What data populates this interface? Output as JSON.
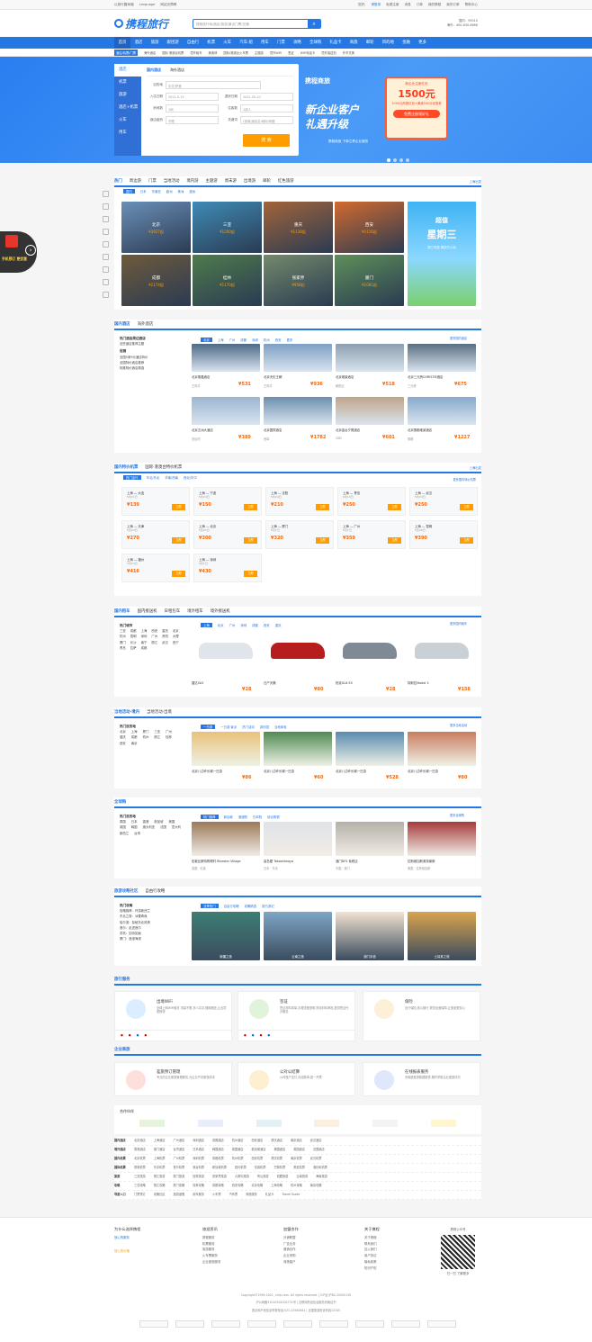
{
  "topbar": {
    "left": [
      "以旅行圆幸福",
      "Language",
      "网站无障碍"
    ],
    "right": [
      "您好,",
      "请登录",
      "免费注册",
      "消息",
      "订单",
      "我的携程",
      "我的订单",
      "帮助中心"
    ]
  },
  "header": {
    "logo": "携程旅行",
    "search_placeholder": "搜索旅行地/酒店/旅游/景点门票/交通",
    "hotline1": "国内：95010",
    "hotline2": "海外：400-830-6666"
  },
  "nav": [
    "首页",
    "酒店",
    "旅游",
    "跟团游",
    "自由行",
    "机票",
    "火车",
    "汽车·船",
    "用车",
    "门票",
    "攻略",
    "全球购",
    "礼品卡",
    "商旅",
    "邮轮",
    "目的地",
    "金融",
    "更多"
  ],
  "subnav": {
    "tag": "酒店/机票/门票",
    "items": [
      "海外酒店",
      "国际·港澳台机票",
      "境外租车",
      "美食林",
      "国际/港澳台火车票",
      "主题游",
      "境外WiFi",
      "签证",
      "WiFi电话卡",
      "境外接送机",
      "外币兑换"
    ]
  },
  "booking": {
    "side_tabs": [
      "酒店",
      "机票",
      "旅游",
      "酒店+机票",
      "火车",
      "用车"
    ],
    "tabs": [
      "国内酒店",
      "海外酒店"
    ],
    "labels": {
      "dest": "目的地",
      "checkin": "入住日期",
      "checkout": "退房日期",
      "rooms": "房间数",
      "guests": "住客数",
      "level": "酒店级别",
      "keyword": "关键词"
    },
    "values": {
      "dest": "中文/拼音",
      "checkin": "2021-5-19",
      "checkout": "2021-05-20",
      "rooms": "1间",
      "guests": "1成人",
      "level": "不限",
      "keyword": "(选填)酒店名/地标/商圈"
    },
    "search": "搜 索"
  },
  "promo": {
    "brand": "携程商旅",
    "line1": "新企业客户",
    "line2": "礼遇升级",
    "sub": "携程商旅 下单立享企业服务",
    "card_title": "新企业注册红包",
    "card_amount": "1500元",
    "card_note": "1000元商旅红包+满减500元优惠券",
    "card_btn": "免费注册领好礼"
  },
  "float_red": {
    "title": "手机预订 更优惠"
  },
  "dest": {
    "tabs": [
      "热门",
      "周边游",
      "门票",
      "当地活动",
      "境内游",
      "主题游",
      "周末游",
      "出境游",
      "邮轮",
      "红色旅游"
    ],
    "more": "上海出发",
    "filters": [
      "国内",
      "日本",
      "东南亚",
      "欧洲",
      "美洲",
      "澳洲"
    ],
    "items": [
      {
        "name": "北京",
        "price": "¥3927起"
      },
      {
        "name": "三亚",
        "price": "¥1200起"
      },
      {
        "name": "重庆",
        "price": "¥1138起"
      },
      {
        "name": "西安",
        "price": "¥1116起"
      },
      {
        "name": "成都",
        "price": "¥1174起"
      },
      {
        "name": "桂林",
        "price": "¥1170起"
      },
      {
        "name": "张家界",
        "price": "¥958起"
      },
      {
        "name": "厦门",
        "price": "¥1081起"
      }
    ],
    "ad": {
      "l1": "超值",
      "l2": "星期三",
      "l3": "周三特惠 周末开心玩"
    }
  },
  "hotel": {
    "tabs": [
      "国内酒店",
      "海外酒店"
    ],
    "left_title": "热门酒店周边酒店",
    "left_sub": "这些酒店推荐主题",
    "left_h": "促销",
    "left_items": [
      "全国5家9元酒店特价",
      "全国特价酒店推荐",
      "特推特价酒店精选"
    ],
    "cities": [
      "北京",
      "上海",
      "广州",
      "成都",
      "深圳",
      "杭州",
      "西安",
      "更多"
    ],
    "more": "更多国内酒店",
    "items": [
      {
        "name": "北京丽晶酒店",
        "loc": "王府井",
        "price": "¥531"
      },
      {
        "name": "北京天伦王朝",
        "loc": "王府井",
        "price": "¥936"
      },
      {
        "name": "北京维景酒店",
        "loc": "朝阳区",
        "price": "¥518"
      },
      {
        "name": "北京三元桥CHRISTIE酒店",
        "loc": "三元桥",
        "price": "¥675"
      },
      {
        "name": "北京五洲大酒店",
        "loc": "亚运村",
        "price": "¥389"
      },
      {
        "name": "北京国宾酒店",
        "loc": "西单",
        "price": "¥1782"
      },
      {
        "name": "北京金台夕照酒店",
        "loc": "CBD",
        "price": "¥601"
      },
      {
        "name": "北京丽都维景酒店",
        "loc": "丽都",
        "price": "¥1227"
      }
    ]
  },
  "flight": {
    "tabs": [
      "国内特价机票",
      "国际·港澳台特价机票"
    ],
    "more": "上海出发",
    "filters": [
      "热门出行",
      "华北/东北",
      "华南/西南",
      "西北/华中"
    ],
    "right": "更多国内特价机票",
    "items": [
      {
        "route": "上海 — 大连",
        "date": "5月21日",
        "price": "¥139"
      },
      {
        "route": "上海 — 宁波",
        "date": "5月24日",
        "price": "¥150"
      },
      {
        "route": "上海 — 沈阳",
        "date": "5月24日",
        "price": "¥210"
      },
      {
        "route": "上海 — 青岛",
        "date": "6月10日",
        "price": "¥250"
      },
      {
        "route": "上海 — 武汉",
        "date": "5月24日",
        "price": "¥250"
      },
      {
        "route": "上海 — 天津",
        "date": "5月24日",
        "price": "¥270"
      },
      {
        "route": "上海 — 北京",
        "date": "5月25日",
        "price": "¥300"
      },
      {
        "route": "上海 — 厦门",
        "date": "6月1日",
        "price": "¥320"
      },
      {
        "route": "上海 — 广州",
        "date": "6月1日",
        "price": "¥359"
      },
      {
        "route": "上海 — 昆明",
        "date": "5月26日",
        "price": "¥390"
      },
      {
        "route": "上海 — 福州",
        "date": "5月24日",
        "price": "¥416"
      },
      {
        "route": "上海 — 深圳",
        "date": "6月1日",
        "price": "¥430"
      }
    ],
    "book": "立即"
  },
  "car": {
    "tabs": [
      "国内租车",
      "国内接送机",
      "日租包车",
      "境外租车",
      "境外接送机"
    ],
    "left_title": "热门城市",
    "cities": [
      "三亚",
      "成都",
      "上海",
      "西安",
      "重庆",
      "北京",
      "杭州",
      "昆明",
      "深圳",
      "广州",
      "贵阳",
      "大理",
      "厦门",
      "长沙",
      "南宁",
      "丽江",
      "武汉",
      "西宁",
      "青岛",
      "拉萨",
      "成都"
    ],
    "filters": [
      "上海",
      "北京",
      "广州",
      "深圳",
      "成都",
      "西安",
      "重庆"
    ],
    "more": "更多国内租车",
    "items": [
      {
        "name": "捷达VA3",
        "price": "¥28"
      },
      {
        "name": "日产天籁",
        "price": "¥80"
      },
      {
        "name": "别克GL8 ES",
        "price": "¥28"
      },
      {
        "name": "特斯拉Model 3",
        "price": "¥158"
      }
    ]
  },
  "activity": {
    "tabs": [
      "当地活动·境内",
      "当地活动·出境"
    ],
    "left_title": "热门目的地",
    "cities": [
      "北京",
      "上海",
      "厦门",
      "三亚",
      "广州",
      "重庆",
      "成都",
      "杭州",
      "丽江",
      "桂林",
      "西安",
      "南京"
    ],
    "filters": [
      "一日游",
      "一日游·景点",
      "热门活动",
      "游乐园",
      "当地体验"
    ],
    "more": "更多当地活动",
    "items": [
      {
        "name": "北京八达岭长城一日游",
        "price": "¥86"
      },
      {
        "name": "北京八达岭长城一日游",
        "price": "¥60"
      },
      {
        "name": "北京八达岭长城一日游",
        "price": "¥528"
      },
      {
        "name": "北京八达岭长城一日游",
        "price": "¥80"
      }
    ]
  },
  "shop": {
    "tabs": [
      "全球购"
    ],
    "left_title": "热门目的地",
    "cities": [
      "泰国",
      "日本",
      "香港",
      "新加坡",
      "美国",
      "英国",
      "韩国",
      "澳大利亚",
      "法国",
      "意大利",
      "新西兰",
      "台湾"
    ],
    "filters": [
      "热门推荐",
      "新加坡",
      "港澳购",
      "日本购",
      "综合购物"
    ],
    "more": "更多全球购",
    "items": [
      {
        "name": "佐敦比斯特购物村 Bicester Village",
        "loc": "英国 · 伦敦"
      },
      {
        "name": "高岛屋 Takashimaya",
        "loc": "日本 · 东京"
      },
      {
        "name": "澳门DFS 免税店",
        "loc": "中国 · 澳门"
      },
      {
        "name": "拉斯维加斯奥特莱斯",
        "loc": "美国 · 拉斯维加斯"
      }
    ]
  },
  "guide": {
    "tabs": [
      "旅游攻略社区",
      "自由行攻略"
    ],
    "left_title": "热门攻略",
    "left_items": [
      "攻略推荐：环游新西兰",
      "东北之旅：冰雪奇缘",
      "哈尔滨：探秘东北风情",
      "首尔：走进首尔",
      "苏杭：如诗如画",
      "厦门：浪漫海滨"
    ],
    "filters": [
      "当季热门",
      "自由行攻略",
      "攻略精选",
      "旅行游记"
    ],
    "more": "更多攻略",
    "items": [
      {
        "name": "新疆之旅"
      },
      {
        "name": "云南之旅"
      },
      {
        "name": "澳门手信"
      },
      {
        "name": "土耳其之旅"
      }
    ],
    "shouxin": "澳门手信"
  },
  "services": {
    "title": "旅行服务",
    "items": [
      {
        "name": "出境WiFi",
        "desc": "全球上网WiFi租赁 流量不限,多人共享,随用随还,让出境更畅快"
      },
      {
        "name": "签证",
        "desc": "签证材料简单,办理流程透明 简化材料审批,提供签证代办服务"
      },
      {
        "name": "保险",
        "desc": "出行保险,放心随行 提供全面保障,让旅途更安心"
      }
    ]
  },
  "enterprise": {
    "title": "企业商旅",
    "items": [
      {
        "name": "差旅预订管理",
        "desc": "专业的企业差旅管理服务,为企业节省差旅成本"
      },
      {
        "name": "公对公结算",
        "desc": "公司账户支付,月结账单,统一开票"
      },
      {
        "name": "在线报表服务",
        "desc": "多维度差旅数据报表,随时掌握企业差旅情况"
      }
    ]
  },
  "partners": {
    "title": "合作伙伴"
  },
  "links": [
    {
      "h": "国内酒店",
      "items": [
        "北京酒店",
        "上海酒店",
        "广州酒店",
        "深圳酒店",
        "成都酒店",
        "杭州酒店",
        "西安酒店",
        "重庆酒店",
        "南京酒店",
        "武汉酒店"
      ]
    },
    {
      "h": "境外酒店",
      "items": [
        "香港酒店",
        "澳门酒店",
        "台湾酒店",
        "日本酒店",
        "韩国酒店",
        "泰国酒店",
        "新加坡酒店",
        "美国酒店",
        "英国酒店",
        "法国酒店"
      ]
    },
    {
      "h": "国内机票",
      "items": [
        "北京机票",
        "上海机票",
        "广州机票",
        "深圳机票",
        "成都机票",
        "杭州机票",
        "西安机票",
        "重庆机票",
        "南京机票",
        "武汉机票"
      ]
    },
    {
      "h": "国际机票",
      "items": [
        "香港机票",
        "东京机票",
        "首尔机票",
        "曼谷机票",
        "新加坡机票",
        "纽约机票",
        "伦敦机票",
        "巴黎机票",
        "悉尼机票",
        "洛杉矶机票"
      ]
    },
    {
      "h": "旅游",
      "items": [
        "三亚旅游",
        "丽江旅游",
        "厦门旅游",
        "桂林旅游",
        "张家界旅游",
        "九寨沟旅游",
        "黄山旅游",
        "西藏旅游",
        "云南旅游",
        "海南旅游"
      ]
    },
    {
      "h": "攻略",
      "items": [
        "三亚攻略",
        "丽江攻略",
        "厦门攻略",
        "桂林攻略",
        "成都攻略",
        "西安攻略",
        "北京攻略",
        "上海攻略",
        "杭州攻略",
        "南京攻略"
      ]
    },
    {
      "h": "导游入口",
      "items": [
        "门票预订",
        "攻略社区",
        "旅游度假",
        "用车服务",
        "火车票",
        "汽车票",
        "商旅服务",
        "礼品卡",
        "Travel Guide"
      ]
    }
  ],
  "footer": {
    "why": {
      "title": "为什么选择携程",
      "i1": "放心的服务",
      "i2": "放心的价格"
    },
    "c2": {
      "title": "旅游资讯",
      "items": [
        "携程服务",
        "机票服务",
        "旅游服务",
        "火车票服务",
        "企业差旅服务"
      ]
    },
    "c3": {
      "title": "加盟合作",
      "items": [
        "分销联盟",
        "广告业务",
        "营销合作",
        "企业采购",
        "商旅客户"
      ]
    },
    "c4": {
      "title": "关于携程",
      "items": [
        "关于携程",
        "联系我们",
        "加入我们",
        "用户协议",
        "隐私政策",
        "知识产权"
      ]
    },
    "qr": "携程公众号",
    "qr2": "扫一扫 了解更多",
    "copy1": "Copyright©1999-2021, ctrip.com. All rights reserved. | ICP证:沪B2-20050130",
    "copy2": "沪公网备31010502002731号 | 互联网药品信息服务资格证书",
    "copy3": "违法和不良信息举报电话:021-22500841 | 全国旅游投诉热线12345"
  }
}
